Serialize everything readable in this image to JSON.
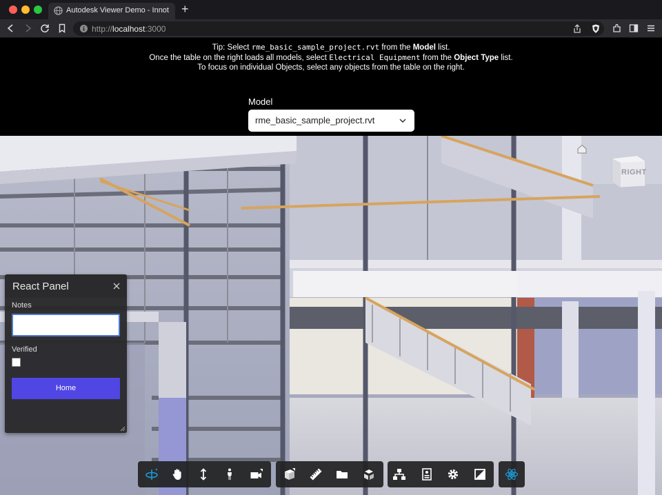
{
  "browser": {
    "tab_title": "Autodesk Viewer Demo - Innot",
    "new_tab_label": "+",
    "url_scheme": "http://",
    "url_host": "localhost",
    "url_port": ":3000",
    "icons": [
      "back-icon",
      "forward-icon",
      "reload-icon",
      "bookmark-icon",
      "share-icon",
      "brave-shield-icon",
      "extensions-icon",
      "sidebar-icon",
      "menu-icon"
    ]
  },
  "tip": {
    "line1_pre": "Tip: Select ",
    "line1_code": "rme_basic_sample_project.rvt",
    "line1_mid": " from the ",
    "line1_bold": "Model",
    "line1_post": " list.",
    "line2_pre": "Once the table on the right loads all models, select ",
    "line2_code": "Electrical Equipment",
    "line2_mid": " from the ",
    "line2_bold": "Object Type",
    "line2_post": " list.",
    "line3": "To focus on individual Objects, select any objects from the table on the right."
  },
  "model": {
    "label": "Model",
    "selected": "rme_basic_sample_project.rvt"
  },
  "viewcube": {
    "face_label": "RIGHT"
  },
  "panel": {
    "title": "React Panel",
    "notes_label": "Notes",
    "notes_value": "",
    "verified_label": "Verified",
    "verified_checked": false,
    "home_button": "Home"
  },
  "toolbar": {
    "groups": [
      [
        "orbit-icon",
        "pan-icon",
        "zoom-icon",
        "first-person-icon",
        "camera-icon"
      ],
      [
        "section-icon",
        "measure-icon",
        "model-browser-icon",
        "explode-icon"
      ],
      [
        "structure-icon",
        "properties-icon",
        "settings-icon",
        "fullscreen-icon"
      ],
      [
        "react-icon"
      ]
    ],
    "active_tool": "orbit-icon"
  },
  "colors": {
    "accent_button": "#5046e4",
    "input_focus": "#4d7ad4",
    "tool_active": "#1b9bd7"
  }
}
